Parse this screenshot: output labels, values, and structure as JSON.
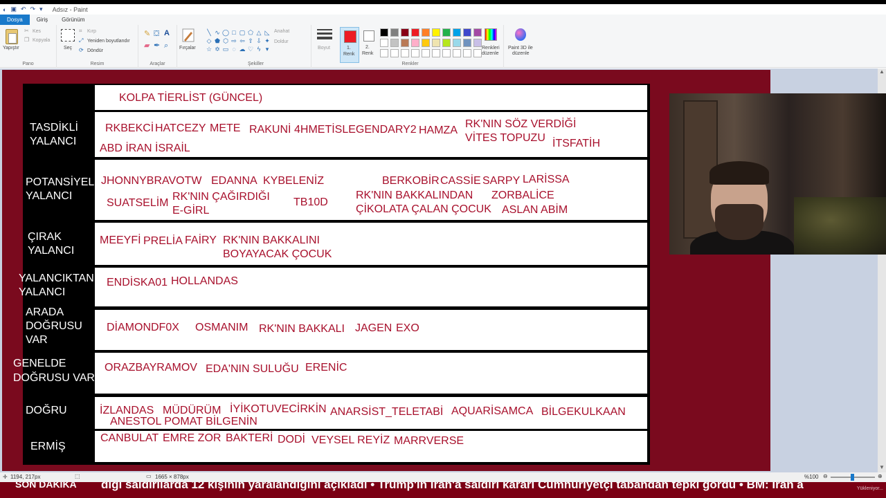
{
  "window": {
    "title": "Adsız - Paint"
  },
  "tabs": [
    {
      "label": "Dosya",
      "active": true
    },
    {
      "label": "Giriş",
      "active": false
    },
    {
      "label": "Görünüm",
      "active": false
    }
  ],
  "ribbon": {
    "pano": {
      "label": "Pano",
      "paste": "Yapıştır",
      "cut": "Kes",
      "copy": "Kopyala"
    },
    "resim": {
      "label": "Resim",
      "select": "Seç",
      "crop": "Kırp",
      "resize": "Yeniden boyutlandır",
      "rotate": "Döndür"
    },
    "araclar": {
      "label": "Araçlar"
    },
    "brushes": {
      "label": "Fırçalar"
    },
    "sekiller": {
      "label": "Şekiller",
      "outline": "Anahat",
      "fill": "Doldur"
    },
    "size": {
      "label": "Boyut"
    },
    "renkler": {
      "label": "Renkler",
      "color1_line1": "1.",
      "color1_line2": "Renk",
      "color2_line1": "2.",
      "color2_line2": "Renk",
      "color1": "#ed1c24",
      "color2": "#ffffff",
      "palette": [
        "#000000",
        "#7f7f7f",
        "#880015",
        "#ed1c24",
        "#ff7f27",
        "#fff200",
        "#22b14c",
        "#00a2e8",
        "#3f48cc",
        "#a349a4",
        "#ffffff",
        "#c3c3c3",
        "#b97a57",
        "#ffaec9",
        "#ffc90e",
        "#efe4b0",
        "#b5e61d",
        "#99d9ea",
        "#7092be",
        "#c8bfe7",
        "#ffffff",
        "#ffffff",
        "#ffffff",
        "#ffffff",
        "#ffffff",
        "#ffffff",
        "#ffffff",
        "#ffffff",
        "#ffffff",
        "#ffffff"
      ],
      "edit_colors_line1": "Renkleri",
      "edit_colors_line2": "düzenle",
      "paint3d_line1": "Paint 3D ile",
      "paint3d_line2": "düzenle"
    }
  },
  "tierlist": {
    "header": "KOLPA TİERLİST (GÜNCEL)",
    "tiers": [
      {
        "label": "TASDİKLİ YALANCI",
        "names": [
          "RKBEKCİ",
          "HATCEZY",
          "METE",
          "RAKUNİ",
          "4HMETİSLEGENDARY2",
          "HAMZA",
          "RK'NIN SÖZ VERDİĞİ VİTES TOPUZU",
          "İTSFATİH",
          "ABD İRAN İSRAİL"
        ]
      },
      {
        "label": "POTANSİYEL YALANCI",
        "names": [
          "JHONNYBRAVOTW",
          "EDANNA",
          "KYBELENİZ",
          "BERKOBİR",
          "CASSİE",
          "SARPY",
          "LARİSSA",
          "SUATSELİM",
          "RK'NIN ÇAĞIRDIĞI E-GİRL",
          "TB10D",
          "RK'NIN BAKKALINDAN ÇİKOLATA ÇALAN ÇOCUK",
          "ZORBALİCE",
          "ASLAN ABİM"
        ]
      },
      {
        "label": "ÇIRAK YALANCI",
        "names": [
          "MEEYFİ",
          "PRELİA",
          "FAİRY",
          "RK'NIN BAKKALINI BOYAYACAK ÇOCUK"
        ]
      },
      {
        "label": "YALANCIKTAN YALANCI",
        "names": [
          "ENDİSKA01",
          "HOLLANDAS"
        ]
      },
      {
        "label": "ARADA DOĞRUSU VAR",
        "names": [
          "DİAMONDF0X",
          "OSMANIM",
          "RK'NIN BAKKALI",
          "JAGEN",
          "EXO"
        ]
      },
      {
        "label": "GENELDE DOĞRUSU VAR",
        "names": [
          "ORAZBAYRAMOV",
          "EDA'NIN SULUĞU",
          "ERENİC"
        ]
      },
      {
        "label": "DOĞRU",
        "names": [
          "İZLANDAS",
          "MÜDÜRÜM",
          "İYİKOTUVECİRKİN",
          "ANARSİST_TELETABİ",
          "AQUARİSAMCA",
          "BİLGEKULKAAN",
          "ANESTOL POMAT BİLGENİN"
        ]
      },
      {
        "label": "ERMİŞ",
        "names": [
          "CANBULAT",
          "EMRE ZOR",
          "BAKTERİ",
          "DODİ",
          "VEYSEL REYİZ",
          "MARRVERSE"
        ]
      }
    ]
  },
  "statusbar": {
    "cursor": "1194, 217px",
    "canvas_size": "1665 × 878px",
    "zoom": "%100"
  },
  "ticker": {
    "badge": "SON DAKİKA",
    "text": "dığı saldırılarda 12 kişinin yaralandığını açıkladı  •  Trump'ın İran'a saldırı kararı Cumhuriyetçi tabandan tepki gördü  •  BM: İran a",
    "uploading": "Yükleniyor..."
  }
}
